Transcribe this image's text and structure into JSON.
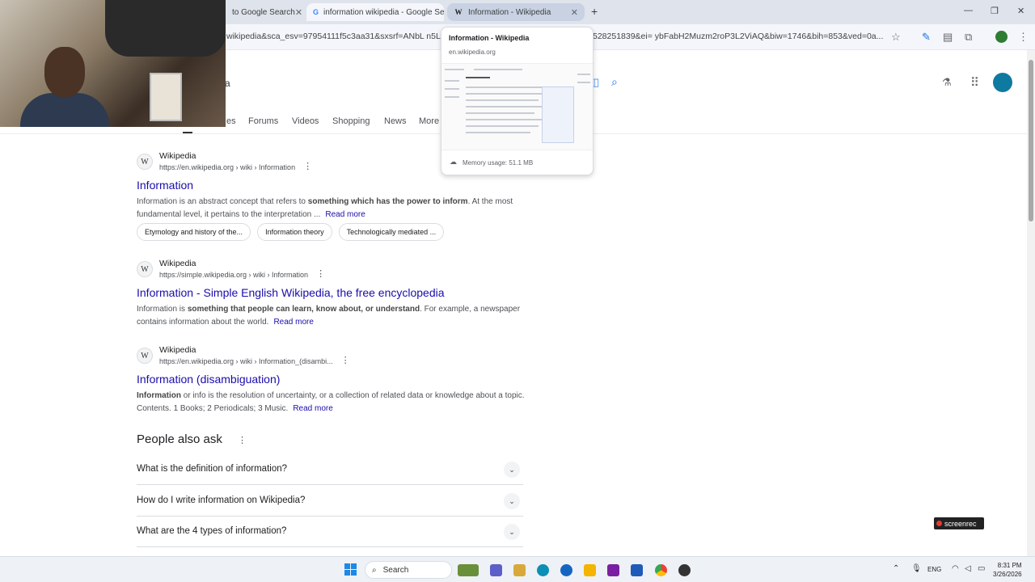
{
  "browser": {
    "tabs": [
      {
        "label": "to Google Search",
        "close": "✕"
      },
      {
        "label": "information wikipedia - Google Se",
        "close": "✕"
      },
      {
        "label": "Information - Wikipedia",
        "close": "✕"
      }
    ],
    "new_tab": "+",
    "window_controls": {
      "minimize": "—",
      "restore": "❐",
      "close": "✕"
    },
    "url_left": "wikipedia&sca_esv=97954111f5c3aa31&sxsrf=ANbL n5Lx",
    "url_right": "528251839&ei= ybFabH2Muzm2roP3L2ViAQ&biw=1746&bih=853&ved=0a..."
  },
  "hovercard": {
    "title": "Information - Wikipedia",
    "domain": "en.wikipedia.org",
    "memory": "Memory usage: 51.1 MB"
  },
  "search": {
    "query_tail": "a",
    "nav_tabs": [
      "es",
      "Forums",
      "Videos",
      "Shopping",
      "News",
      "More"
    ]
  },
  "results": [
    {
      "site": "Wikipedia",
      "url": "https://en.wikipedia.org › wiki › Information",
      "title": "Information",
      "snippet_bold": "",
      "snippet_a": "Information is an abstract concept that refers to ",
      "snippet_b": "something which has the power to inform",
      "snippet_c": ". At the most fundamental level, it pertains to the interpretation ...",
      "read_more": "Read more",
      "chips": [
        "Etymology and history of the...",
        "Information theory",
        "Technologically mediated ..."
      ]
    },
    {
      "site": "Wikipedia",
      "url": "https://simple.wikipedia.org › wiki › Information",
      "title": "Information - Simple English Wikipedia, the free encyclopedia",
      "snippet_a": "Information is ",
      "snippet_b": "something that people can learn, know about, or understand",
      "snippet_c": ". For example, a newspaper contains information about the world.",
      "read_more": "Read more"
    },
    {
      "site": "Wikipedia",
      "url": "https://en.wikipedia.org › wiki › Information_(disambi...",
      "title": "Information (disambiguation)",
      "snippet_a": "",
      "snippet_b": "Information",
      "snippet_c": " or info is the resolution of uncertainty, or a collection of related data or knowledge about a topic. Contents. 1 Books; 2 Periodicals; 3 Music.",
      "read_more": "Read more"
    }
  ],
  "people_also_ask": {
    "title": "People also ask",
    "questions": [
      "What is the definition of information?",
      "How do I write information on Wikipedia?",
      "What are the 4 types of information?"
    ]
  },
  "screenrec": "screenrec",
  "taskbar": {
    "search_label": "Search",
    "language": "ENG",
    "time": "8:31 PM",
    "date": "3/26/2026"
  },
  "icons": {
    "kebab": "⋮",
    "chevron": "⌄",
    "star": "☆",
    "magnifier": "🔍"
  }
}
